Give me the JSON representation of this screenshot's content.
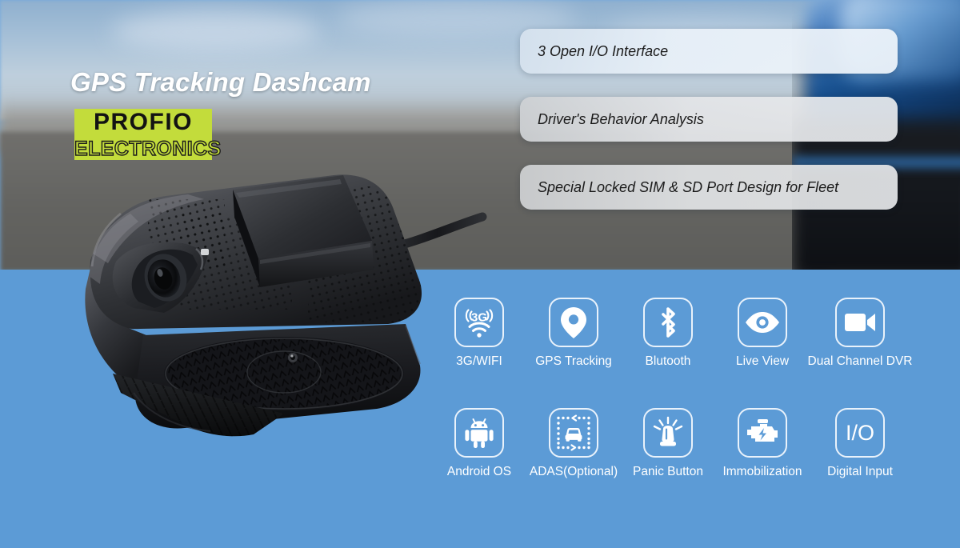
{
  "hero": {
    "title": "GPS Tracking Dashcam",
    "logo_primary": "PROFIO",
    "logo_secondary": "ELECTRONICS",
    "product_name": "gps-tracking-dashcam-device"
  },
  "colors": {
    "panel_blue": "#5c9bd6",
    "logo_green": "#c3dc3b",
    "title_white": "#ffffff",
    "pill_text": "#1b1b1b",
    "icon_white": "#ffffff"
  },
  "features": [
    {
      "id": "open-io-interface",
      "label": "3 Open I/O Interface"
    },
    {
      "id": "driver-behavior-analysis",
      "label": "Driver's Behavior Analysis"
    },
    {
      "id": "locked-sim-sd-port",
      "label": "Special Locked SIM & SD Port Design for Fleet"
    }
  ],
  "icon_grid": {
    "row1": [
      {
        "icon": "3g-wifi-icon",
        "label": "3G/WIFI"
      },
      {
        "icon": "map-pin-icon",
        "label": "GPS Tracking"
      },
      {
        "icon": "bluetooth-icon",
        "label": "Blutooth"
      },
      {
        "icon": "eye-icon",
        "label": "Live View"
      },
      {
        "icon": "video-camera-icon",
        "label": "Dual Channel DVR"
      }
    ],
    "row2": [
      {
        "icon": "android-robot-icon",
        "label": "Android OS"
      },
      {
        "icon": "adas-car-icon",
        "label": "ADAS(Optional)"
      },
      {
        "icon": "siren-beacon-icon",
        "label": "Panic Button"
      },
      {
        "icon": "engine-bolt-icon",
        "label": "Immobilization"
      },
      {
        "icon": "io-text-icon",
        "label": "Digital Input"
      }
    ]
  },
  "icon_glyph_text": {
    "three_g": "3G",
    "io": "I/O"
  }
}
